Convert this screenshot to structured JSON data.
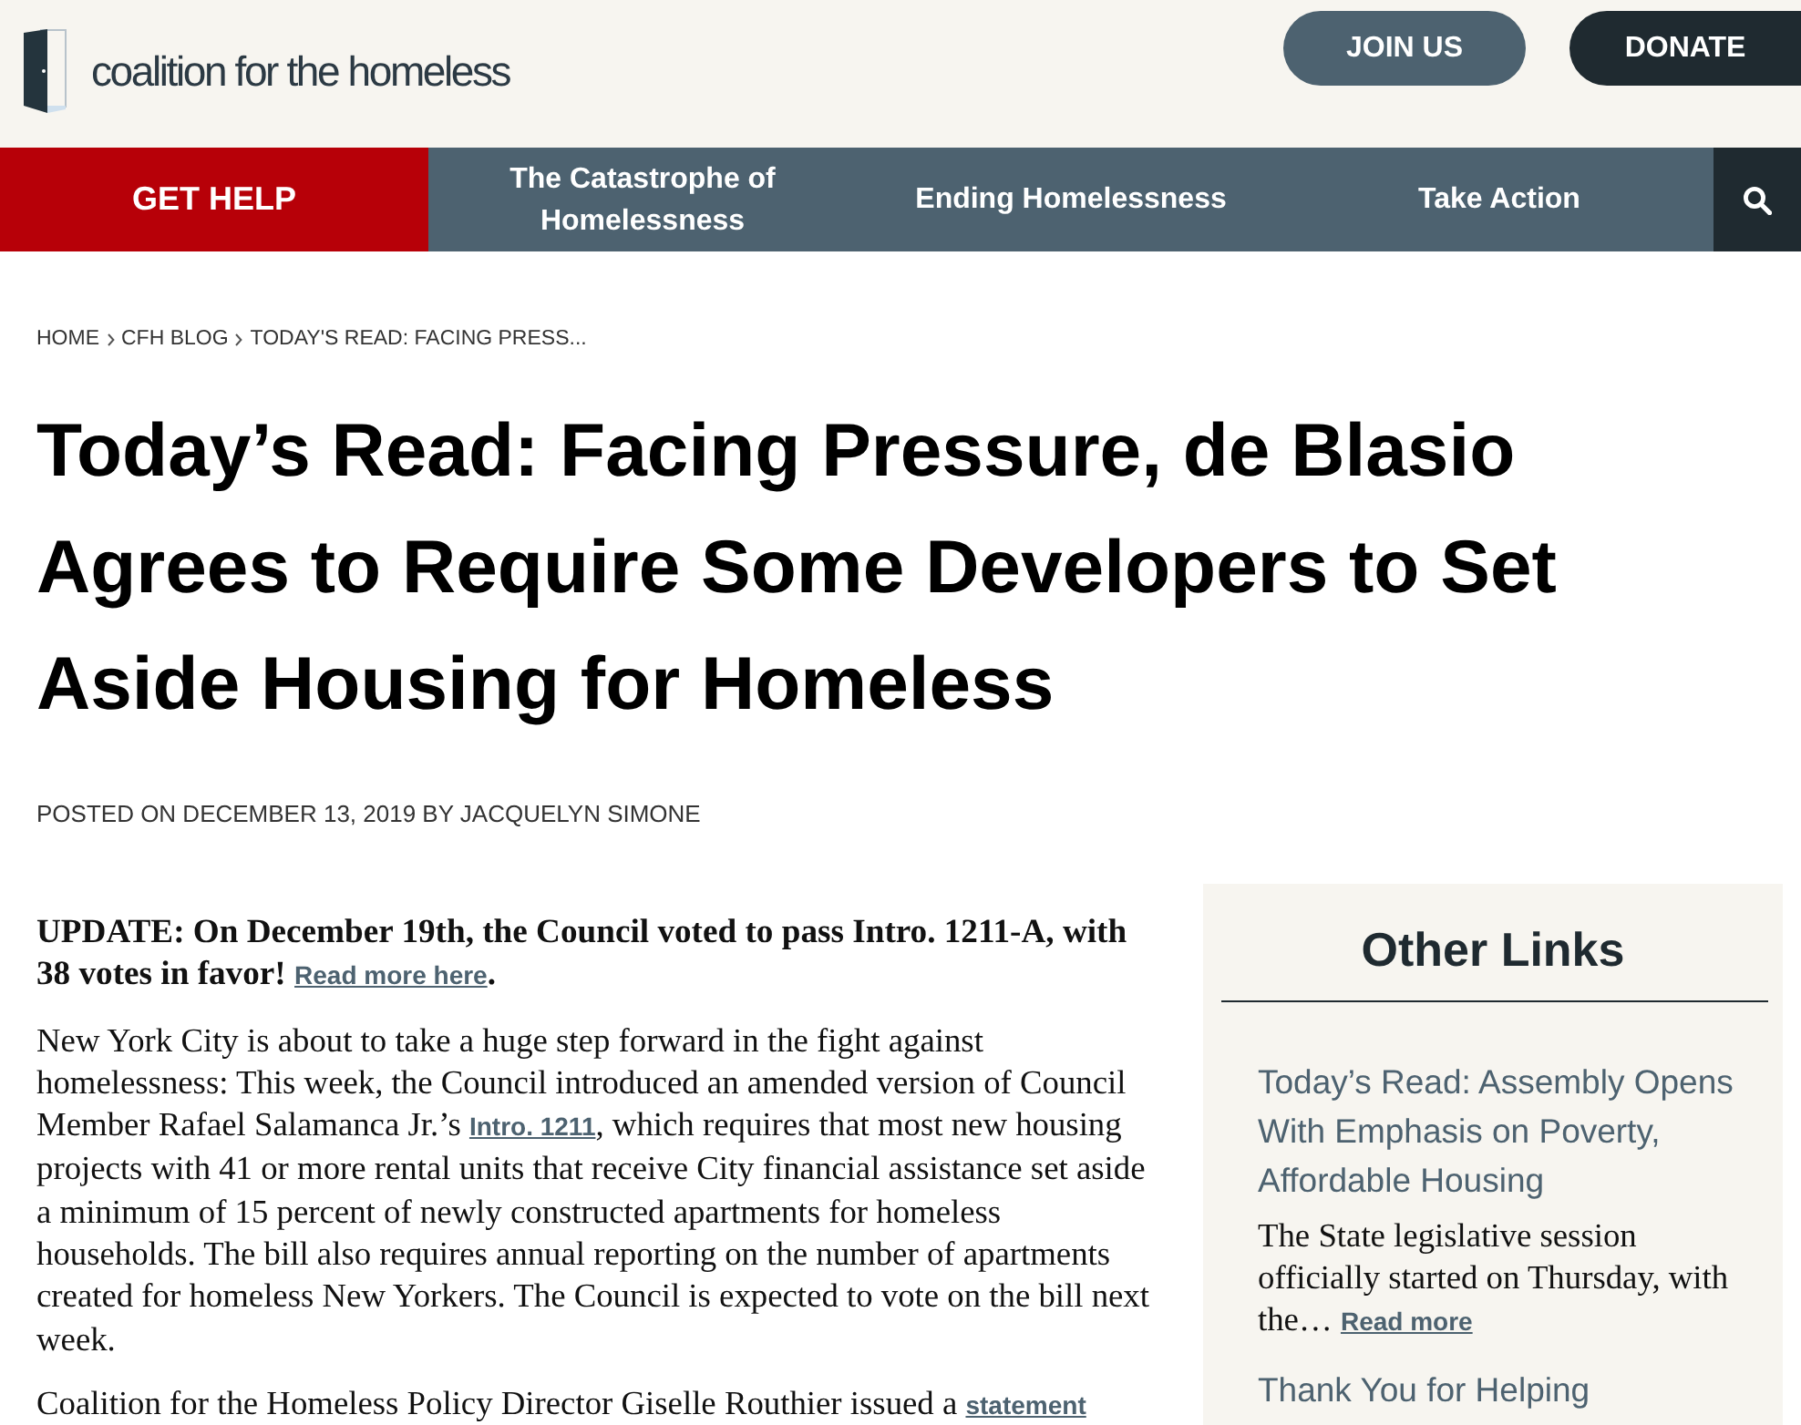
{
  "header": {
    "logo": "coalition for the homeless",
    "buttons": [
      {
        "label": "JOIN US",
        "kind": "secondary"
      },
      {
        "label": "DONATE",
        "kind": "primary"
      }
    ]
  },
  "nav": {
    "items": [
      {
        "label": "GET HELP",
        "kind": "highlight"
      },
      {
        "label": "The Catastrophe of Homelessness",
        "kind": "link"
      },
      {
        "label": "Ending Homelessness",
        "kind": "link"
      },
      {
        "label": "Take Action",
        "kind": "link"
      }
    ]
  },
  "breadcrumb": [
    "HOME",
    "CFH BLOG",
    "TODAY'S READ: FACING PRESS..."
  ],
  "article": {
    "title": "Today’s Read: Facing Pressure, de Blasio Agrees to Require Some Developers to Set Aside Housing for Homeless",
    "byline": "POSTED ON DECEMBER 13, 2019 BY JACQUELYN SIMONE",
    "update": {
      "text": "UPDATE: On December 19th, the Council voted to pass Intro. 1211-A, with 38 votes in favor!",
      "link": "Read more here",
      "after": "."
    },
    "paragraphs": [
      {
        "parts": [
          {
            "kind": "text",
            "text": "New York City is about to take a huge step forward in the fight against homelessness: This week, the Council introduced an amended version of Council Member Rafael Salamanca Jr.’s "
          },
          {
            "kind": "link",
            "text": "Intro. 1211"
          },
          {
            "kind": "text",
            "text": ", which requires that most new housing projects with 41 or more rental units that receive City financial assistance set aside a minimum of 15 percent of newly constructed apartments for homeless households. The bill also requires annual reporting on the number of apartments created for homeless New Yorkers. The Council is expected to vote on the bill next week."
          }
        ]
      },
      {
        "parts": [
          {
            "kind": "text",
            "text": "Coalition for the Homeless Policy Director Giselle Routhier issued a "
          },
          {
            "kind": "link",
            "text": "statement"
          }
        ]
      }
    ]
  },
  "sidebar": {
    "title": "Other Links",
    "items": [
      {
        "title": "Today’s Read: Assembly Opens With Emphasis on Poverty, Affordable Housing",
        "excerpt": "The State legislative session officially started on Thursday, with the…",
        "link": "Read more"
      },
      {
        "title": "Thank You for Helping"
      }
    ]
  }
}
